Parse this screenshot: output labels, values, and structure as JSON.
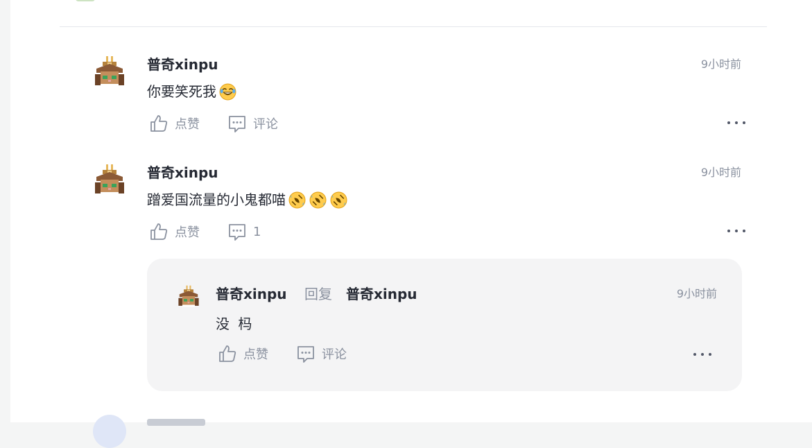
{
  "comments": [
    {
      "author": "普奇xinpu",
      "time": "9小时前",
      "text": "你要笑死我",
      "emojis": [
        "laugh-tears"
      ],
      "like_label": "点赞",
      "comment_label": "评论"
    },
    {
      "author": "普奇xinpu",
      "time": "9小时前",
      "text": "蹭爱国流量的小鬼都喵",
      "emojis": [
        "rofl",
        "rofl",
        "rofl"
      ],
      "like_label": "点赞",
      "comment_label": "1"
    }
  ],
  "reply": {
    "author": "普奇xinpu",
    "reply_word": "回复",
    "target": "普奇xinpu",
    "time": "9小时前",
    "text": "没 杩",
    "like_label": "点赞",
    "comment_label": "评论"
  },
  "colors": {
    "text_primary": "#252933",
    "text_secondary": "#8a919f",
    "reply_bg": "#f4f4f5",
    "divider": "#e4e6eb"
  },
  "icons": [
    "thumbs-up-icon",
    "comment-icon",
    "more-icon",
    "avatar-samurai-cat"
  ]
}
